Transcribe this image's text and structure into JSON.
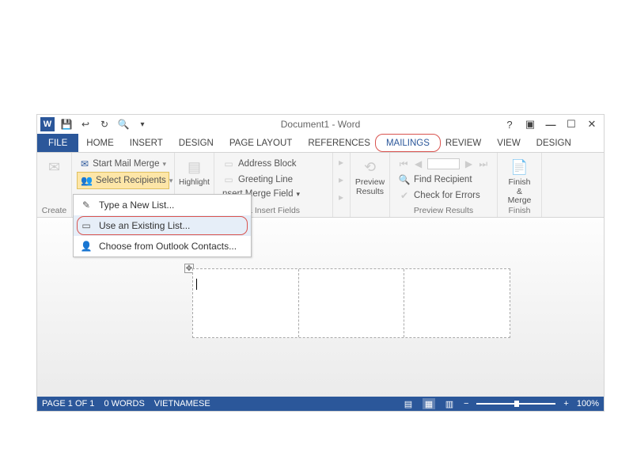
{
  "title": "Document1 - Word",
  "tabs": {
    "file": "FILE",
    "home": "HOME",
    "insert": "INSERT",
    "design": "DESIGN",
    "page_layout": "PAGE LAYOUT",
    "references": "REFERENCES",
    "mailings": "MAILINGS",
    "review": "REVIEW",
    "view": "VIEW",
    "design2": "DESIGN"
  },
  "ribbon": {
    "create": {
      "label": "Create"
    },
    "start_merge": {
      "start_mail_merge": "Start Mail Merge",
      "select_recipients": "Select Recipients",
      "highlight": "Highlight"
    },
    "write_insert": {
      "address_block": "Address Block",
      "greeting_line": "Greeting Line",
      "insert_merge_field": "nsert Merge Field",
      "group_label": "& Insert Fields"
    },
    "preview": {
      "preview_results": "Preview\nResults",
      "find_recipient": "Find Recipient",
      "check_errors": "Check for Errors",
      "group_label": "Preview Results"
    },
    "finish": {
      "finish_merge": "Finish &\nMerge",
      "group_label": "Finish"
    }
  },
  "dropdown": {
    "type_new": "Type a New List...",
    "use_existing": "Use an Existing List...",
    "outlook": "Choose from Outlook Contacts..."
  },
  "status": {
    "page": "PAGE 1 OF 1",
    "words": "0 WORDS",
    "lang": "VIETNAMESE",
    "zoom": "100%",
    "zoom_minus": "−",
    "zoom_plus": "+"
  }
}
